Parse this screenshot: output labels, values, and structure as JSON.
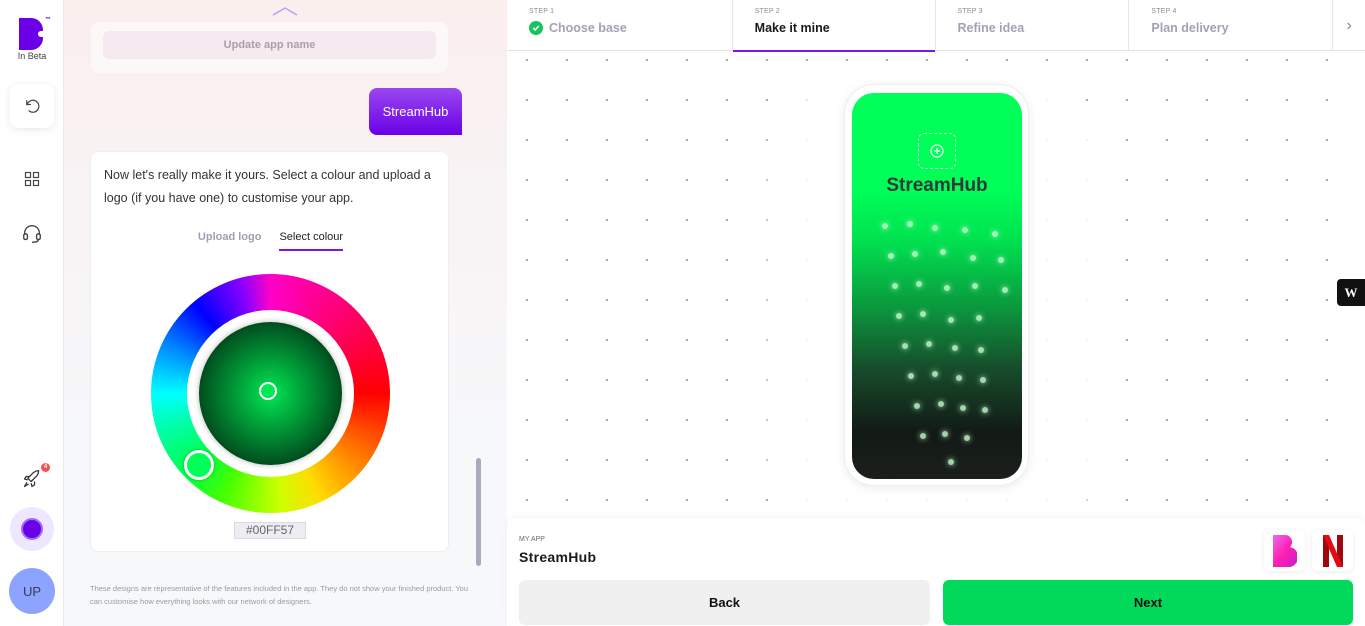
{
  "rail": {
    "logo_text": "B",
    "trademark": "™",
    "beta_label": "In Beta",
    "rocket_badge_count": "4",
    "avatar_initials": "UP",
    "theme_color": "#6b00e6"
  },
  "chat": {
    "update_name_button": "Update app name",
    "user_message": "StreamHub",
    "assistant_message": "Now let's really make it yours. Select a colour and upload a logo (if you have one) to customise your app.",
    "tabs": [
      {
        "label": "Upload logo",
        "active": false
      },
      {
        "label": "Select colour",
        "active": true
      }
    ],
    "color_picker": {
      "hex_value": "#00FF57",
      "hue_degrees": 141
    },
    "disclaimer": "These designs are representative of the features included in the app. They do not show your finished product. You can customise how everything looks with our network of designers."
  },
  "stepper": {
    "steps": [
      {
        "number": "STEP 1",
        "title": "Choose base",
        "status": "complete"
      },
      {
        "number": "STEP 2",
        "title": "Make it mine",
        "status": "active"
      },
      {
        "number": "STEP 3",
        "title": "Refine idea",
        "status": "upcoming"
      },
      {
        "number": "STEP 4",
        "title": "Plan delivery",
        "status": "upcoming"
      }
    ],
    "next_arrow": "›"
  },
  "preview": {
    "app_name": "StreamHub",
    "primary_color": "#00FF57",
    "webflow_badge": "W"
  },
  "footer": {
    "my_app_label": "MY APP",
    "app_name": "StreamHub",
    "back_label": "Back",
    "next_label": "Next",
    "next_color": "#00D95A"
  }
}
